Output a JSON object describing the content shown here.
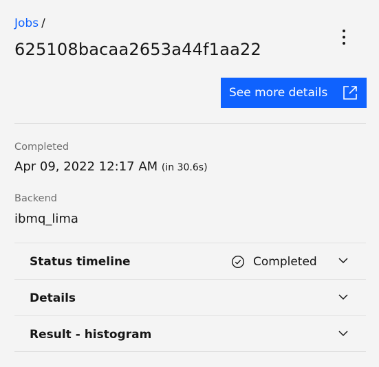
{
  "breadcrumb": {
    "link_label": "Jobs",
    "separator": "/"
  },
  "job": {
    "id": "625108bacaa2653a44f1aa22"
  },
  "actions": {
    "overflow_icon": "overflow-menu-vertical-icon",
    "see_more_label": "See more details",
    "see_more_icon": "launch-icon"
  },
  "fields": {
    "completed_label": "Completed",
    "completed_value": "Apr 09, 2022 12:17 AM",
    "completed_duration": "(in 30.6s)",
    "backend_label": "Backend",
    "backend_value": "ibmq_lima"
  },
  "accordion": {
    "items": [
      {
        "title": "Status timeline",
        "status": "Completed",
        "status_icon": "checkmark-outline-icon"
      },
      {
        "title": "Details"
      },
      {
        "title": "Result - histogram"
      }
    ],
    "chevron_icon": "chevron-down-icon"
  },
  "colors": {
    "background": "#f4f4f4",
    "primary": "#0f62fe",
    "text": "#161616",
    "secondary_text": "#6f6f6f",
    "divider": "#e0e0e0"
  }
}
